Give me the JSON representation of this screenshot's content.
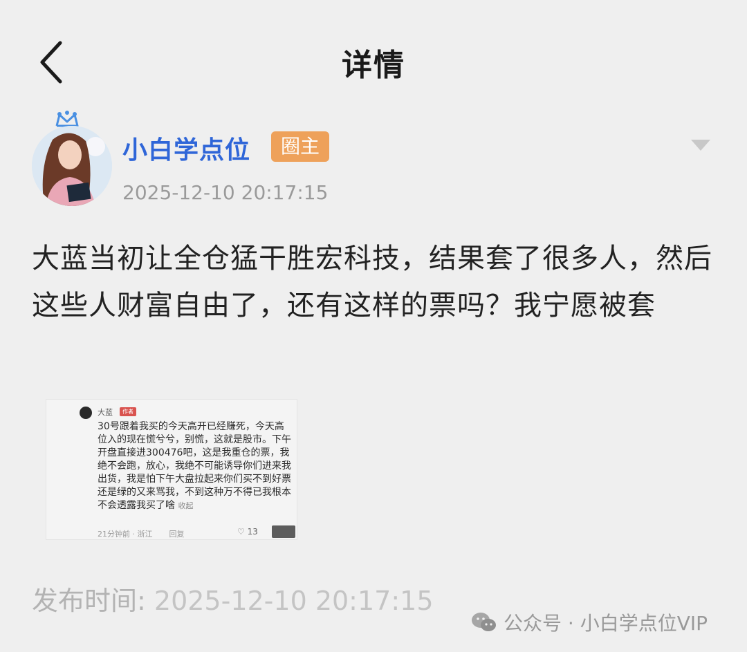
{
  "header": {
    "title": "详情"
  },
  "post": {
    "author": {
      "name": "小白学点位",
      "badge": "圈主"
    },
    "time": "2025-12-10 20:17:15",
    "content": "大蓝当初让全仓猛干胜宏科技，结果套了很多人，然后这些人财富自由了，还有这样的票吗？我宁愿被套",
    "image": {
      "user": "大蓝",
      "tag": "作者",
      "text": "30号跟着我买的今天高开已经赚死，今天高位入的现在慌兮兮，别慌，这就是股市。下午开盘直接进300476吧，这是我重仓的票，我绝不会跑，放心，我绝不可能诱导你们进来我出货，我是怕下午大盘拉起来你们买不到好票还是绿的又来骂我，不到这种万不得已我根本不会透露我买了啥",
      "collapse": "收起",
      "meta_time": "21分钟前 · 浙江",
      "reply": "回复",
      "likes": "13"
    }
  },
  "publish": {
    "label": "发布时间:",
    "value": "2025-12-10 20:17:15"
  },
  "watermark": {
    "text": "公众号 · 小白学点位VIP"
  },
  "colors": {
    "author": "#2f66d8",
    "badge": "#eea15a",
    "background": "#efefef"
  }
}
